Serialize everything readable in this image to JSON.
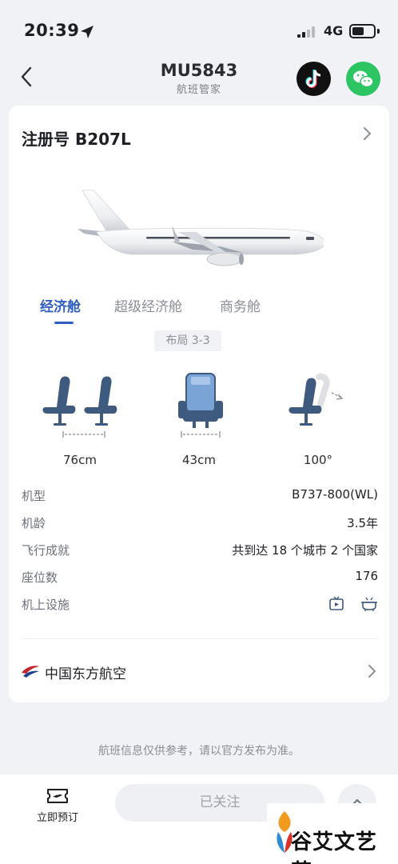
{
  "status_bar": {
    "time": "20:39",
    "network": "4G"
  },
  "header": {
    "flight_number": "MU5843",
    "subtitle": "航班管家"
  },
  "card": {
    "registration": "注册号 B207L",
    "tabs": [
      {
        "label": "经济舱",
        "active": true
      },
      {
        "label": "超级经济舱",
        "active": false
      },
      {
        "label": "商务舱",
        "active": false
      }
    ],
    "layout": "布局 3-3",
    "seats": [
      {
        "value": "76cm",
        "icon": "seat-pitch-icon"
      },
      {
        "value": "43cm",
        "icon": "seat-width-icon"
      },
      {
        "value": "100°",
        "icon": "seat-recline-icon"
      }
    ],
    "info": [
      {
        "label": "机型",
        "value": "B737-800(WL)"
      },
      {
        "label": "机龄",
        "value": "3.5年"
      },
      {
        "label": "飞行成就",
        "value": "共到达 18 个城市 2 个国家"
      },
      {
        "label": "座位数",
        "value": "176"
      },
      {
        "label": "机上设施",
        "value": ""
      }
    ],
    "airline": "中国东方航空"
  },
  "disclaimer": "航班信息仅供参考，请以官方发布为准。",
  "bottom": {
    "book_label": "立即预订",
    "follow_label": "已关注"
  },
  "watermark": "谷艾文艺苑",
  "colors": {
    "accent": "#2f5ec2",
    "wechat": "#2dc464",
    "seat_blue": "#3e5a7e"
  }
}
